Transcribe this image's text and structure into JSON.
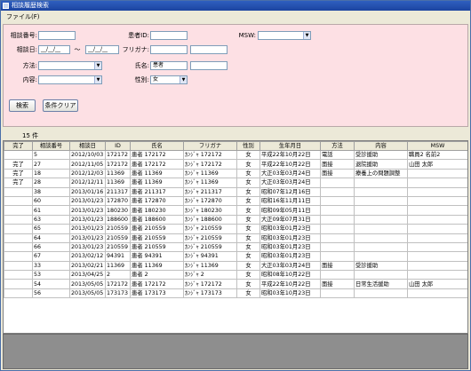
{
  "window": {
    "title": "相談履歴検索"
  },
  "menu": {
    "file": "ファイル(F)"
  },
  "form": {
    "soudan_no_label": "相談番号:",
    "soudan_date_label": "相談日:",
    "date_from": "__/__/__",
    "date_to": "__/__/__",
    "tilde": "〜",
    "houhou_label": "方法:",
    "naiyou_label": "内容:",
    "patient_id_label": "患者ID:",
    "furigana_label": "フリガナ:",
    "name_label": "氏名:",
    "name_value": "患者",
    "sex_label": "性別:",
    "sex_value": "女",
    "msw_label": "MSW:"
  },
  "buttons": {
    "search": "検索",
    "clear": "条件クリア"
  },
  "result_count": "15  件",
  "table": {
    "headers": [
      "完了",
      "相談番号",
      "相談日",
      "ID",
      "氏名",
      "フリガナ",
      "性別",
      "生年月日",
      "方法",
      "内容",
      "MSW"
    ],
    "rows": [
      [
        "",
        "5",
        "2012/10/03",
        "172172",
        "患者 172172",
        "ｶﾝｼﾞｬ 172172",
        "女",
        "平成22年10月22日",
        "電話",
        "受診援助",
        "職員2 名前2"
      ],
      [
        "完了",
        "27",
        "2012/11/05",
        "172172",
        "患者 172172",
        "ｶﾝｼﾞｬ 172172",
        "女",
        "平成22年10月22日",
        "面接",
        "退院援助",
        "山田 太郎"
      ],
      [
        "完了",
        "18",
        "2012/12/03",
        "11369",
        "患者 11369",
        "ｶﾝｼﾞｬ 11369",
        "女",
        "大正03年03月24日",
        "面接",
        "療養上の問題調整",
        ""
      ],
      [
        "完了",
        "28",
        "2012/12/11",
        "11369",
        "患者 11369",
        "ｶﾝｼﾞｬ 11369",
        "女",
        "大正03年03月24日",
        "",
        "",
        ""
      ],
      [
        "",
        "38",
        "2013/01/16",
        "211317",
        "患者 211317",
        "ｶﾝｼﾞｬ 211317",
        "女",
        "昭和07年12月16日",
        "",
        "",
        ""
      ],
      [
        "",
        "60",
        "2013/01/23",
        "172870",
        "患者 172870",
        "ｶﾝｼﾞｬ 172870",
        "女",
        "昭和16年11月11日",
        "",
        "",
        ""
      ],
      [
        "",
        "61",
        "2013/01/23",
        "180230",
        "患者 180230",
        "ｶﾝｼﾞｬ 180230",
        "女",
        "昭和09年05月11日",
        "",
        "",
        ""
      ],
      [
        "",
        "63",
        "2013/01/23",
        "188600",
        "患者 188600",
        "ｶﾝｼﾞｬ 188600",
        "女",
        "大正09年07月31日",
        "",
        "",
        ""
      ],
      [
        "",
        "65",
        "2013/01/23",
        "210559",
        "患者 210559",
        "ｶﾝｼﾞｬ 210559",
        "女",
        "昭和03年01月23日",
        "",
        "",
        ""
      ],
      [
        "",
        "64",
        "2013/01/23",
        "210559",
        "患者 210559",
        "ｶﾝｼﾞｬ 210559",
        "女",
        "昭和03年01月23日",
        "",
        "",
        ""
      ],
      [
        "",
        "66",
        "2013/01/23",
        "210559",
        "患者 210559",
        "ｶﾝｼﾞｬ 210559",
        "女",
        "昭和03年01月23日",
        "",
        "",
        ""
      ],
      [
        "",
        "67",
        "2013/02/12",
        "94391",
        "患者 94391",
        "ｶﾝｼﾞｬ 94391",
        "女",
        "昭和03年01月23日",
        "",
        "",
        ""
      ],
      [
        "",
        "33",
        "2013/02/21",
        "11369",
        "患者 11369",
        "ｶﾝｼﾞｬ 11369",
        "女",
        "大正03年03月24日",
        "面接",
        "受診援助",
        ""
      ],
      [
        "",
        "53",
        "2013/04/25",
        "2",
        "患者 2",
        "ｶﾝｼﾞｬ 2",
        "女",
        "昭和08年10月22日",
        "",
        "",
        ""
      ],
      [
        "",
        "54",
        "2013/05/05",
        "172172",
        "患者 172172",
        "ｶﾝｼﾞｬ 172172",
        "女",
        "平成22年10月22日",
        "面接",
        "日常生活援助",
        "山田 太郎"
      ],
      [
        "",
        "56",
        "2013/05/05",
        "173173",
        "患者 173173",
        "ｶﾝｼﾞｬ 173173",
        "女",
        "昭和03年10月23日",
        "",
        "",
        ""
      ]
    ]
  }
}
